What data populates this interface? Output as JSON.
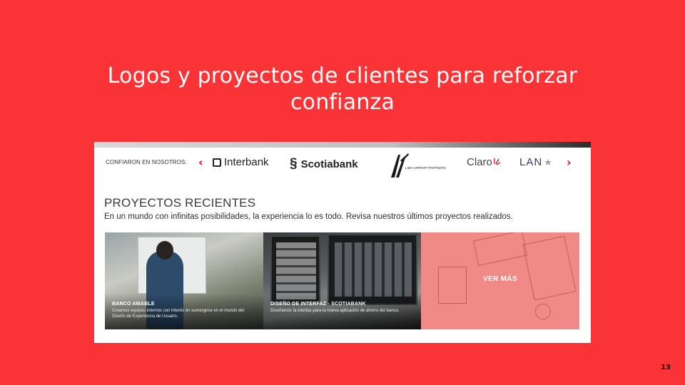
{
  "slide": {
    "title_line1": "Logos y proyectos de clientes para reforzar",
    "title_line2": "confianza",
    "page_number": "13",
    "background_color": "#f93336"
  },
  "logos_bar": {
    "label": "CONFIARON EN NOSOTROS:",
    "prev_icon": "chevron-left-icon",
    "next_icon": "chevron-right-icon",
    "prev_glyph": "‹",
    "next_glyph": "›",
    "logos": [
      {
        "name": "Interbank",
        "text": "Interbank"
      },
      {
        "name": "Scotiabank",
        "text": "Scotiabank"
      },
      {
        "name": "Lima Airport Partners",
        "text": "LIMA AIRPORT PARTNERS"
      },
      {
        "name": "Claro",
        "text": "Claro"
      },
      {
        "name": "LAN",
        "text": "LAN"
      }
    ]
  },
  "projects": {
    "title": "PROYECTOS RECIENTES",
    "subtitle": "En un mundo con infinitas posibilidades, la experiencia lo es todo. Revisa  nuestros últimos proyectos realizados.",
    "cards": [
      {
        "title": "BANCO AMABLE",
        "description": "Creamos equipos internos con interés en sumergirse en el mundo del Diseño de Experiencia de Usuario."
      },
      {
        "title": "DISEÑO DE INTERFAZ - SCOTIABANK",
        "description": "Diseñamos la interfaz para la nueva aplicación de ahorro del banco."
      },
      {
        "title": "VER MÁS",
        "accent_color": "#f08a87"
      }
    ]
  }
}
